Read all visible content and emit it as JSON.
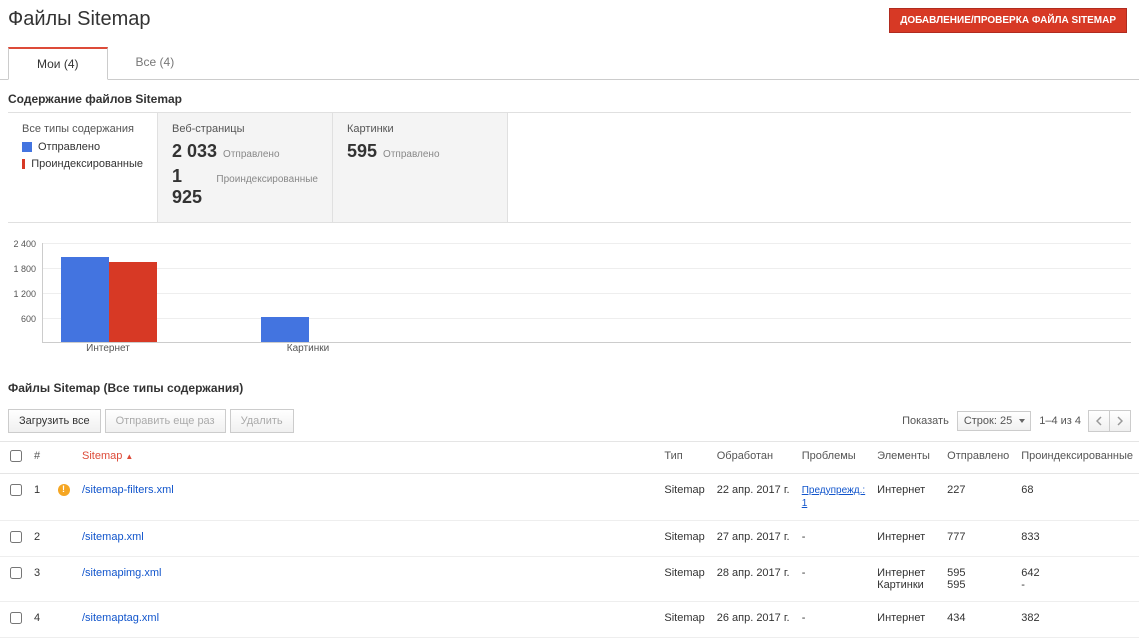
{
  "header": {
    "title": "Файлы Sitemap",
    "add_button": "ДОБАВЛЕНИЕ/ПРОВЕРКА ФАЙЛА SITEMAP"
  },
  "tabs": [
    {
      "label": "Мои (4)",
      "active": true
    },
    {
      "label": "Все (4)",
      "active": false
    }
  ],
  "content_section": {
    "title": "Содержание файлов Sitemap",
    "filter_box": {
      "heading": "Все типы содержания",
      "legend_sent": "Отправлено",
      "legend_indexed": "Проиндексированные"
    },
    "web_box": {
      "heading": "Веб-страницы",
      "sent_value": "2 033",
      "sent_label": "Отправлено",
      "indexed_value": "1 925",
      "indexed_label": "Проиндексированные"
    },
    "img_box": {
      "heading": "Картинки",
      "sent_value": "595",
      "sent_label": "Отправлено"
    }
  },
  "chart_data": {
    "type": "bar",
    "y_ticks": [
      "2 400",
      "1 800",
      "1 200",
      "600"
    ],
    "ylim": [
      0,
      2400
    ],
    "categories": [
      "Интернет",
      "Картинки"
    ],
    "series": [
      {
        "name": "Отправлено",
        "color": "#4374e0",
        "values": [
          2033,
          595
        ]
      },
      {
        "name": "Проиндексированные",
        "color": "#d73925",
        "values": [
          1925,
          0
        ]
      }
    ]
  },
  "table_section": {
    "title": "Файлы Sitemap (Все типы содержания)",
    "toolbar": {
      "download_all": "Загрузить все",
      "resend": "Отправить еще раз",
      "delete": "Удалить"
    },
    "pager": {
      "show_label": "Показать",
      "rows_label": "Строк: 25",
      "range": "1–4 из 4"
    },
    "columns": {
      "idx": "#",
      "sitemap": "Sitemap",
      "sort_arrow": "▲",
      "type": "Тип",
      "processed": "Обработан",
      "issues": "Проблемы",
      "elements": "Элементы",
      "sent": "Отправлено",
      "indexed": "Проиндексированные"
    },
    "rows": [
      {
        "idx": "1",
        "warn": true,
        "name": "/sitemap-filters.xml",
        "type": "Sitemap",
        "date": "22 апр. 2017 г.",
        "issues": "Предупрежд.: 1",
        "elements": "Интернет",
        "sent": "227",
        "indexed": "68"
      },
      {
        "idx": "2",
        "warn": false,
        "name": "/sitemap.xml",
        "type": "Sitemap",
        "date": "27 апр. 2017 г.",
        "issues": "-",
        "elements": "Интернет",
        "sent": "777",
        "indexed": "833"
      },
      {
        "idx": "3",
        "warn": false,
        "name": "/sitemapimg.xml",
        "type": "Sitemap",
        "date": "28 апр. 2017 г.",
        "issues": "-",
        "elements_multi": [
          [
            "Интернет",
            "595",
            "642"
          ],
          [
            "Картинки",
            "595",
            "-"
          ]
        ]
      },
      {
        "idx": "4",
        "warn": false,
        "name": "/sitemaptag.xml",
        "type": "Sitemap",
        "date": "26 апр. 2017 г.",
        "issues": "-",
        "elements": "Интернет",
        "sent": "434",
        "indexed": "382"
      }
    ]
  }
}
